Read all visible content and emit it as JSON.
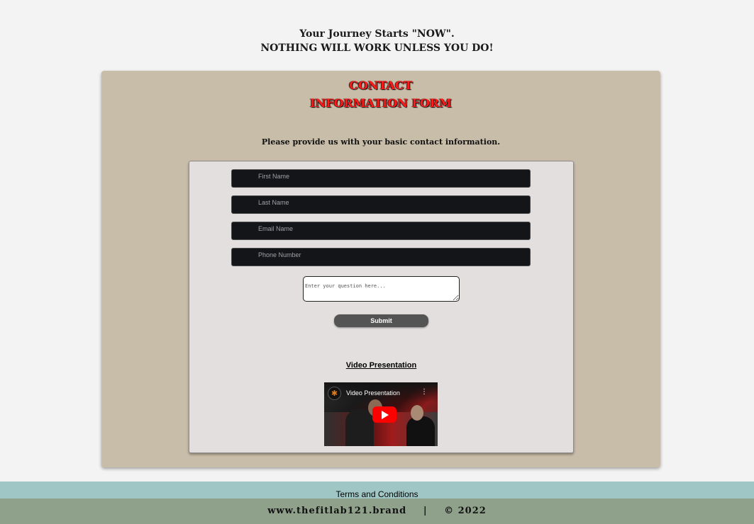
{
  "header": {
    "line1": "Your Journey Starts \"NOW\".",
    "line2": "NOTHING WILL WORK UNLESS YOU DO!"
  },
  "form": {
    "title_line1": "CONTACT",
    "title_line2": "INFORMATION FORM",
    "instructions": "Please provide us with your basic contact information.",
    "fields": {
      "first_name": {
        "placeholder": "First Name",
        "value": ""
      },
      "last_name": {
        "placeholder": "Last Name",
        "value": ""
      },
      "email": {
        "placeholder": "Email Name",
        "value": ""
      },
      "phone": {
        "placeholder": "Phone Number",
        "value": ""
      }
    },
    "question": {
      "placeholder": "Enter your question here...",
      "value": ""
    },
    "submit_label": "Submit"
  },
  "video": {
    "link_label": "Video Presentation",
    "embed_title": "Video Presentation",
    "menu_glyph": "⋮",
    "avatar_glyph": "✱"
  },
  "footer": {
    "terms_label": "Terms and Conditions",
    "site": "www.thefitlab121.brand",
    "separator": "|",
    "copyright": "© 2022"
  },
  "colors": {
    "page_bg": "#f4f3f3",
    "outer_panel": "#c8bda8",
    "inner_panel": "#e2dfde",
    "field_bg": "#131519",
    "title_red": "#ff1a1a",
    "submit_bg": "#545454",
    "footer_top": "#9fc6c4",
    "footer_bottom": "#8fa18b",
    "play_red": "#ff0000"
  }
}
